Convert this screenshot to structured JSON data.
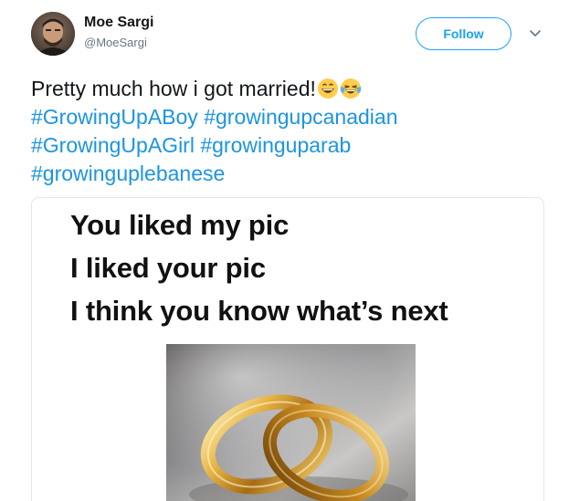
{
  "user": {
    "display_name": "Moe Sargi",
    "handle": "@MoeSargi"
  },
  "header": {
    "follow_label": "Follow",
    "menu_icon": "chevron-down-icon",
    "accent_color": "#1da1f2"
  },
  "tweet": {
    "text": "Pretty much how i got married!",
    "emojis": [
      "grinning-face-emoji",
      "face-with-tears-of-joy-emoji"
    ],
    "hashtags": [
      "#GrowingUpABoy",
      "#growingupcanadian",
      "#GrowingUpAGirl",
      "#growinguparab",
      "#growinguplebanese"
    ]
  },
  "media": {
    "lines": [
      "You liked my pic",
      "I liked your pic",
      "I think you know what’s next"
    ],
    "image": "wedding-rings-photo"
  }
}
